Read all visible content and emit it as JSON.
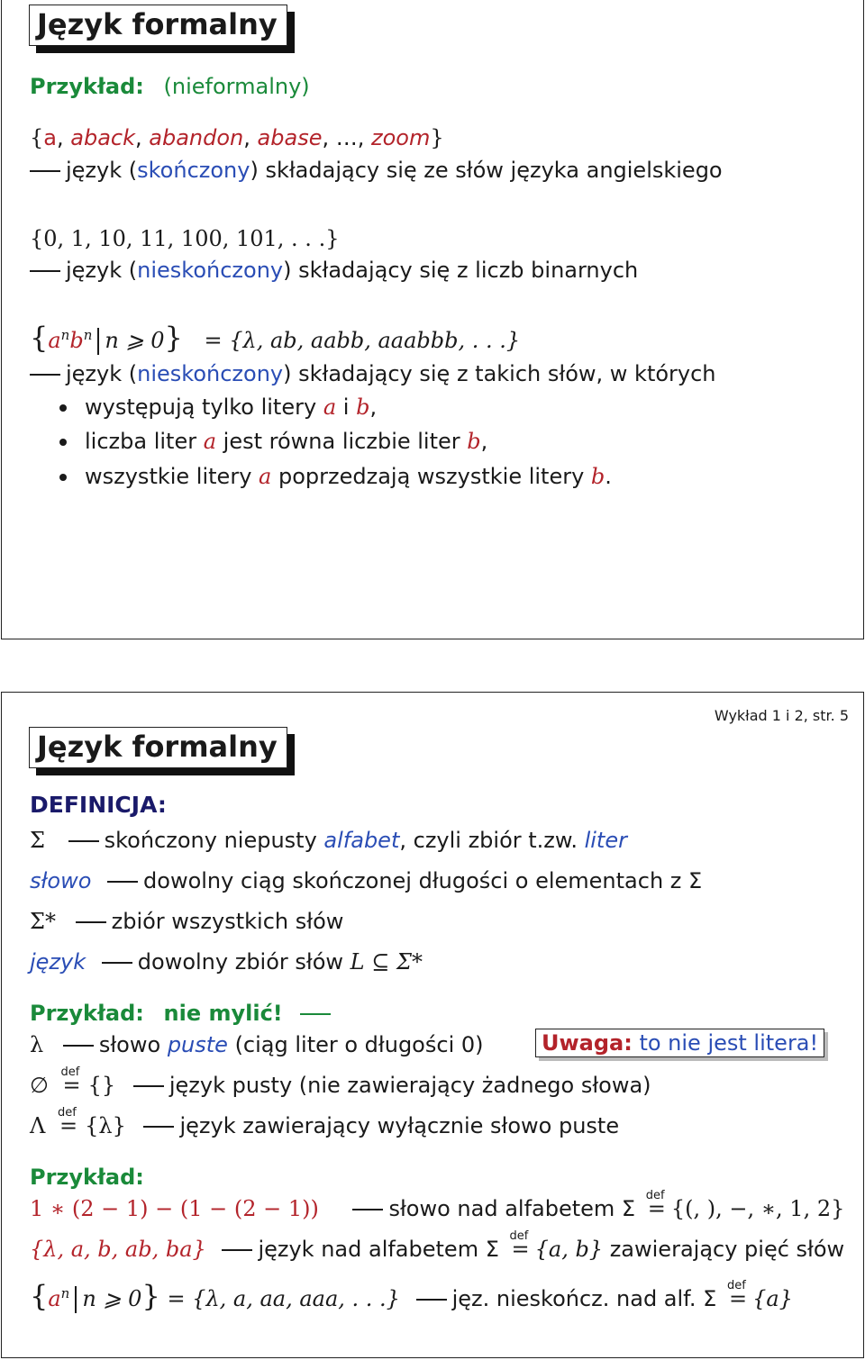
{
  "slide1": {
    "title": "Język formalny",
    "example_label": "Przykład:",
    "example_kind": "(nieformalny)",
    "l1_open": "{",
    "l1_words": [
      "a",
      "aback",
      "abandon",
      "abase"
    ],
    "l1_dots": "…",
    "l1_last": "zoom",
    "l1_close": "}",
    "l2_a": "język (",
    "l2_b": "skończony",
    "l2_c": ") składający się ze słów języka angielskiego",
    "l3": "{0, 1, 10, 11, 100, 101, . . .}",
    "l4_a": "język (",
    "l4_b": "nieskończony",
    "l4_c": ") składający się z liczb binarnych",
    "l5_a": "a",
    "l5_n1": "n",
    "l5_b": "b",
    "l5_n2": "n",
    "l5_cond": "n ⩾ 0",
    "l5_rhs": "= {λ, ab, aabb, aaabbb, . . .}",
    "l6_a": "język (",
    "l6_b": "nieskończony",
    "l6_c": ") składający się z takich słów, w których",
    "b1_a": "występują tylko litery ",
    "b1_x": "a",
    "b1_m": " i ",
    "b1_y": "b",
    "b1_e": ",",
    "b2_a": "liczba liter ",
    "b2_x": "a",
    "b2_m": " jest równa liczbie liter ",
    "b2_y": "b",
    "b2_e": ",",
    "b3_a": "wszystkie litery ",
    "b3_x": "a",
    "b3_m": " poprzedzają wszystkie litery ",
    "b3_y": "b",
    "b3_e": "."
  },
  "slide2": {
    "page": "Wykład 1 i 2, str. 5",
    "title": "Język formalny",
    "def_label": "DEFINICJA:",
    "d1_sym": "Σ",
    "d1_a": "skończony niepusty ",
    "d1_b": "alfabet",
    "d1_c": ", czyli zbiór t.zw. ",
    "d1_d": "liter",
    "d2_a": "słowo",
    "d2_b": "dowolny ciąg skończonej długości o elementach z Σ",
    "d3_a": "Σ*",
    "d3_b": "zbiór wszystkich słów",
    "d4_a": "język",
    "d4_b": "dowolny zbiór słów ",
    "d4_c": "L ⊆ Σ*",
    "ex1_label": "Przykład:",
    "ex1_b": "nie mylić!",
    "e1_a": "λ",
    "e1_b": "słowo ",
    "e1_c": "puste",
    "e1_d": " (ciąg liter o długości 0)",
    "note_a": "Uwaga:",
    "note_b": " to nie jest litera!",
    "def_word": "def",
    "e2_a": "∅",
    "e2_b": "{}",
    "e2_c": "język pusty (nie zawierający żadnego słowa)",
    "e3_a": "Λ",
    "e3_b": "{λ}",
    "e3_c": "język zawierający wyłącznie słowo puste",
    "ex2_label": "Przykład:",
    "f1_a": "1 ∗ (2 − 1) − (1 − (2 − 1))",
    "f1_b": "słowo nad alfabetem Σ",
    "f1_c": "{(, ), −, ∗, 1, 2}",
    "f2_a": "{λ, a, b, ab, ba}",
    "f2_b": "język nad alfabetem Σ",
    "f2_c": "{a, b}",
    "f2_d": " zawierający pięć słów",
    "f3_a": "a",
    "f3_n": "n",
    "f3_cond": "n ⩾ 0",
    "f3_rhs": "= {λ, a, aa, aaa, . . .}",
    "f3_b": "jęz. nieskończ. nad alf. Σ",
    "f3_c": "{a}"
  }
}
